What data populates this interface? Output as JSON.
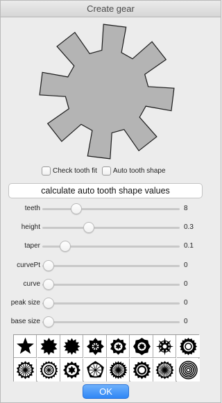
{
  "window": {
    "title": "Create gear"
  },
  "options": {
    "check_tooth_fit": {
      "label": "Check tooth fit",
      "checked": false
    },
    "auto_tooth_shape": {
      "label": "Auto tooth shape",
      "checked": false
    }
  },
  "calc_button": {
    "label": "calculate auto tooth shape values"
  },
  "sliders": [
    {
      "name": "teeth",
      "label": "teeth",
      "value": "8",
      "level": 0.22
    },
    {
      "name": "height",
      "label": "height",
      "value": "0.3",
      "level": 0.32
    },
    {
      "name": "taper",
      "label": "taper",
      "value": "0.1",
      "level": 0.13
    },
    {
      "name": "curvept",
      "label": "curvePt",
      "value": "0",
      "level": 0
    },
    {
      "name": "curve",
      "label": "curve",
      "value": "0",
      "level": 0
    },
    {
      "name": "peak-size",
      "label": "peak size",
      "value": "0",
      "level": 0
    },
    {
      "name": "base-size",
      "label": "base size",
      "value": "0",
      "level": 0
    }
  ],
  "presets": [
    "star-icon",
    "burst-gear-icon",
    "sun-gear-icon",
    "spoked-gear-icon",
    "flower-gear-icon",
    "octagon-gear-icon",
    "spiky-gear-icon",
    "round-gear-icon",
    "radial-gear-icon",
    "ring-gear-icon",
    "cog-gear-icon",
    "pentagon-gear-icon",
    "dense-gear-icon",
    "bold-gear-icon",
    "hatched-gear-icon",
    "striped-disc-icon"
  ],
  "ok_button": {
    "label": "OK"
  },
  "colors": {
    "gear_fill": "#b4b4b4",
    "ok_accent": "#2f86f5"
  }
}
